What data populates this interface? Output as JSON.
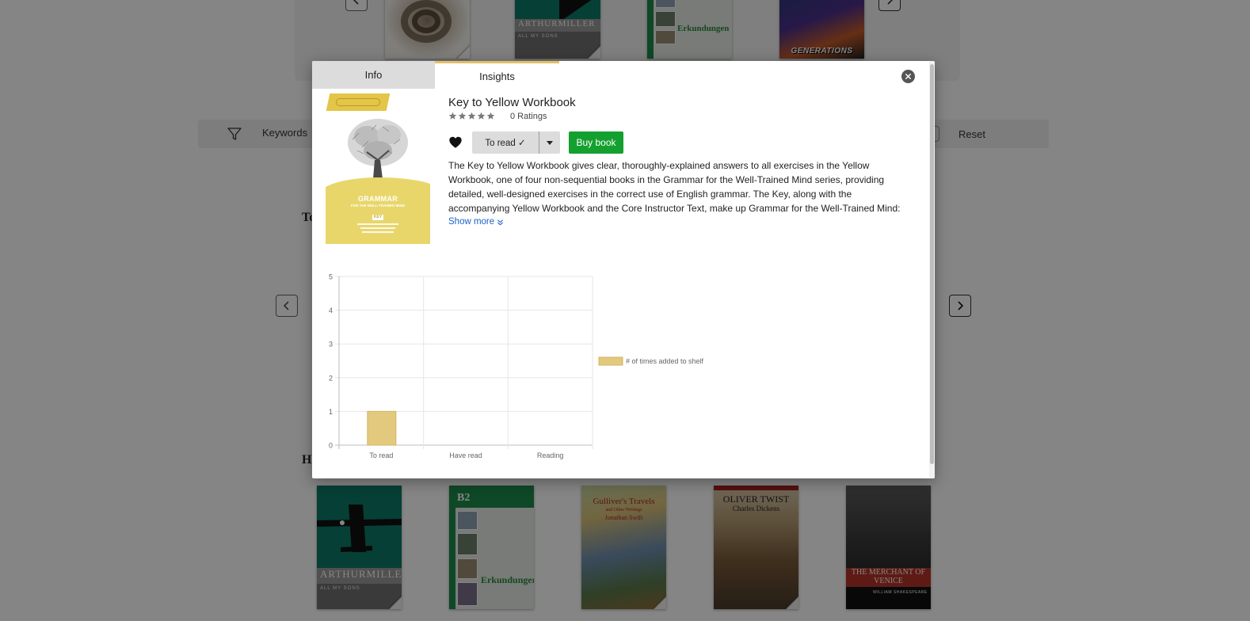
{
  "background": {
    "top_carousel_books": [
      {
        "name": "snake-book"
      },
      {
        "name": "all-my-sons",
        "author": "ARTHURMILLER",
        "subtitle": "ALL MY SONS"
      },
      {
        "name": "erkundungen",
        "title": "Erkundungen"
      },
      {
        "name": "generations",
        "title": "GENERATIONS"
      }
    ],
    "filter_bar": {
      "keywords_label": "Keywords",
      "reset_label": "Reset"
    },
    "section_headings": [
      "To",
      "H"
    ],
    "bottom_carousel_books": [
      {
        "name": "all-my-sons",
        "author": "ARTHURMILLER",
        "subtitle": "ALL MY SONS"
      },
      {
        "name": "erkundungen-b2",
        "badge": "B2",
        "title": "Erkundungen"
      },
      {
        "name": "gullivers-travels",
        "title": "Gulliver's Travels",
        "subtitle": "and Other Writings",
        "author": "Jonathan Swift"
      },
      {
        "name": "oliver-twist",
        "title": "OLIVER TWIST",
        "author": "Charles Dickens"
      },
      {
        "name": "merchant-of-venice",
        "title": "THE MERCHANT OF VENICE",
        "author": "WILLIAM SHAKESPEARE"
      }
    ]
  },
  "modal": {
    "tabs": [
      {
        "label": "Info",
        "active": false
      },
      {
        "label": "Insights",
        "active": true
      }
    ],
    "book": {
      "title": "Key to Yellow Workbook",
      "stars": 0,
      "max_stars": 5,
      "ratings_text": "0 Ratings",
      "cover": {
        "title": "GRAMMAR",
        "subtitle": "FOR THE WELL-TRAINED MIND",
        "edition_badge": "KEY"
      },
      "shelf_button_label": "To read ✓",
      "buy_button_label": "Buy book",
      "description": "The Key to Yellow Workbook gives clear, thoroughly-explained answers to all exercises in the Yellow Workbook, one of four non-sequential books in the Grammar for the Well-Trained Mind series, providing detailed, well-designed exercises in the correct use of English grammar. The Key, along with the accompanying Yellow Workbook and the Core Instructor Text, make up Grammar for the Well-Trained Mind:",
      "show_more_label": "Show more"
    },
    "colors": {
      "tab_active_accent": "#e2c06a",
      "buy_green": "#14a02f",
      "link_blue": "#1a62c7",
      "bar_fill": "#e2c97e",
      "bar_stroke": "#d3b463"
    }
  },
  "chart_data": {
    "type": "bar",
    "categories": [
      "To read",
      "Have read",
      "Reading"
    ],
    "series": [
      {
        "name": "# of times added to shelf",
        "values": [
          1,
          0,
          0
        ]
      }
    ],
    "ylim": [
      0,
      5
    ],
    "yticks": [
      0,
      1,
      2,
      3,
      4,
      5
    ],
    "grid": true,
    "legend": "right"
  }
}
